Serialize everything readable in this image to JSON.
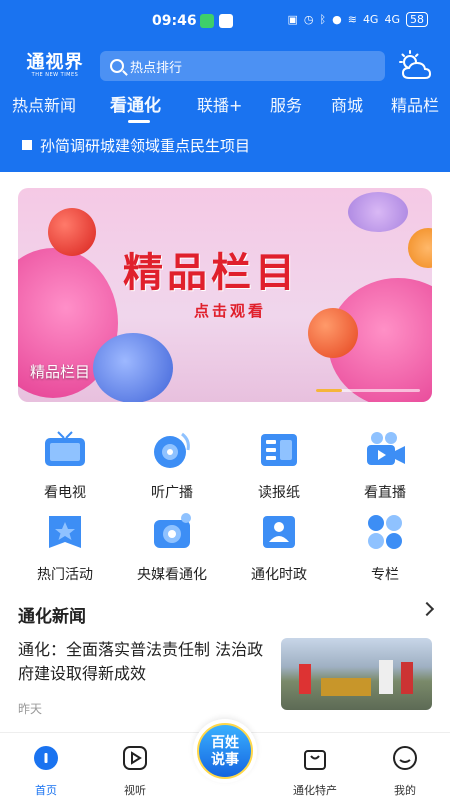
{
  "status_bar": {
    "time": "09:46",
    "battery": "58",
    "signal_left": "4G",
    "signal_right": "4G"
  },
  "header": {
    "logo_main": "通视界",
    "logo_sub": "THE NEW TIMES",
    "search_placeholder": "热点排行",
    "weather_icon": "partly-cloudy-icon",
    "tabs": [
      {
        "label": "热点新闻",
        "active": false
      },
      {
        "label": "看通化",
        "active": true
      },
      {
        "label": "联播+",
        "active": false
      },
      {
        "label": "服务",
        "active": false
      },
      {
        "label": "商城",
        "active": false
      },
      {
        "label": "精品栏",
        "active": false
      }
    ],
    "ticker": "孙简调研城建领域重点民生项目"
  },
  "banner": {
    "title": "精品栏目",
    "subtitle": "点击观看",
    "caption": "精品栏目",
    "page_index": 1
  },
  "services": [
    {
      "label": "看电视",
      "icon": "tv-icon"
    },
    {
      "label": "听广播",
      "icon": "radio-icon"
    },
    {
      "label": "读报纸",
      "icon": "newspaper-icon"
    },
    {
      "label": "看直播",
      "icon": "live-camera-icon"
    },
    {
      "label": "热门活动",
      "icon": "star-flag-icon"
    },
    {
      "label": "央媒看通化",
      "icon": "media-camera-icon"
    },
    {
      "label": "通化时政",
      "icon": "person-card-icon"
    },
    {
      "label": "专栏",
      "icon": "grid-circles-icon"
    }
  ],
  "news": {
    "section_title": "通化新闻",
    "items": [
      {
        "headline": "通化：全面落实普法责任制 法治政府建设取得新成效",
        "time": "昨天"
      }
    ]
  },
  "bottom_nav": {
    "items": [
      {
        "label": "首页",
        "active": true,
        "icon": "home-icon"
      },
      {
        "label": "视听",
        "active": false,
        "icon": "play-icon"
      },
      {
        "label": "通化特产",
        "active": false,
        "icon": "shopping-bag-icon"
      },
      {
        "label": "我的",
        "active": false,
        "icon": "profile-face-icon"
      }
    ],
    "center_label_line1": "百姓",
    "center_label_line2": "说事"
  },
  "colors": {
    "brand_blue": "#1a73f0",
    "banner_red": "#e0202c"
  }
}
